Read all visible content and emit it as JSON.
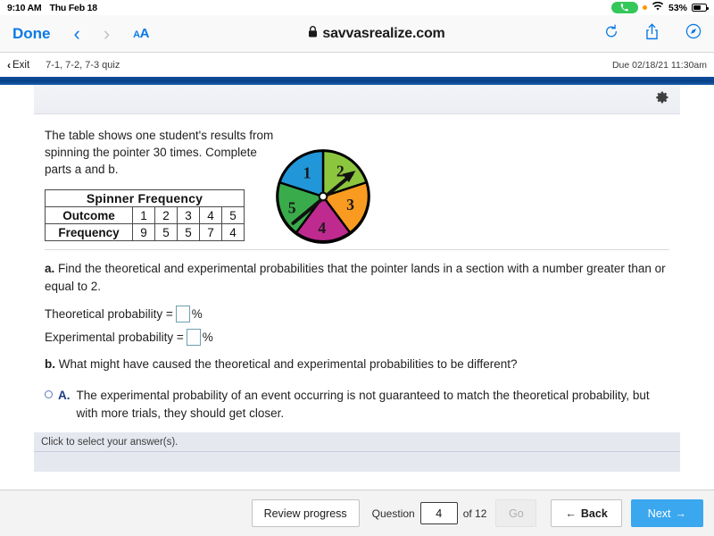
{
  "statusbar": {
    "time": "9:10 AM",
    "date": "Thu Feb 18",
    "battery_percent": "53%",
    "call_icon": "phone-icon",
    "wifi_icon": "wifi-icon",
    "recording_dot": "orange-privacy-dot"
  },
  "browser": {
    "done_label": "Done",
    "back_arrow": "‹",
    "forward_arrow": "›",
    "text_size_big": "A",
    "text_size_small": "A",
    "url": "savvasrealize.com",
    "lock_icon": "lock-icon",
    "reload_icon": "reload-icon",
    "share_icon": "share-icon",
    "compass_icon": "safari-compass-icon"
  },
  "exitbar": {
    "exit_label": "Exit",
    "exit_chevron": "‹",
    "quiz_title": "7-1, 7-2, 7-3 quiz",
    "due": "Due 02/18/21 11:30am"
  },
  "toolbar": {
    "gear_icon": "gear-icon"
  },
  "question": {
    "prompt": "The table shows one student's results from spinning the pointer 30 times. Complete parts a and b.",
    "part_a_label": "a.",
    "part_a_text": " Find the theoretical and experimental probabilities that the pointer lands in a section with a number greater than or equal to 2.",
    "theoretical_label": "Theoretical probability =",
    "experimental_label": "Experimental probability =",
    "theoretical_value": "",
    "experimental_value": "",
    "percent_sign": "%",
    "part_b_label": "b.",
    "part_b_text": " What might have caused the theoretical and experimental probabilities to be different?",
    "option_a_letter": "A.",
    "option_a_text": "The experimental probability of an event occurring is not guaranteed to match the theoretical probability, but with more trials, they should get closer."
  },
  "table": {
    "title": "Spinner Frequency",
    "row_labels": [
      "Outcome",
      "Frequency"
    ],
    "outcomes": [
      "1",
      "2",
      "3",
      "4",
      "5"
    ],
    "frequencies": [
      "9",
      "5",
      "5",
      "7",
      "4"
    ]
  },
  "spinner": {
    "alt": "five-section-spinner",
    "sections": [
      {
        "label": "1",
        "color": "#2196d8"
      },
      {
        "label": "2",
        "color": "#8cc63e"
      },
      {
        "label": "3",
        "color": "#f89b20"
      },
      {
        "label": "4",
        "color": "#bf2a8f"
      },
      {
        "label": "5",
        "color": "#3aab4b"
      }
    ],
    "pointer": "arrow-pointing-upper-right"
  },
  "select_hint": {
    "line1": "Click to select your answer(s).",
    "line2": ""
  },
  "footer": {
    "review_label": "Review progress",
    "question_word": "Question",
    "question_number": "4",
    "of_label": "of 12",
    "go_label": "Go",
    "back_label": "Back",
    "back_arrow": "←",
    "next_label": "Next",
    "next_arrow": "→"
  },
  "colors": {
    "accent_blue": "#3aa7ef",
    "header_blue": "#0a4186",
    "link_blue": "#0b7ae5",
    "select_bar": "#e6e8f0"
  }
}
